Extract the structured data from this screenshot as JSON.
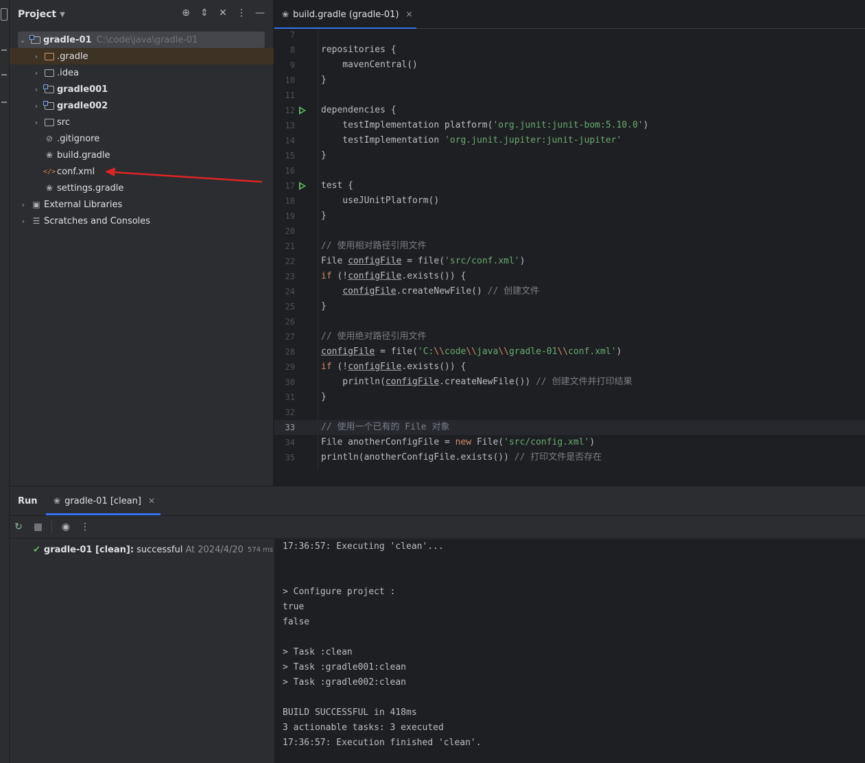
{
  "project_panel": {
    "title": "Project",
    "toolbar_icons": [
      "locate-icon",
      "expand-collapse-icon",
      "collapse-all-icon",
      "more-vertical-icon",
      "minimize-icon"
    ],
    "tree": [
      {
        "label": "gradle-01",
        "path": "C:\\code\\java\\gradle-01",
        "icon": "module-folder-icon",
        "expanded": true,
        "bold": true
      },
      {
        "label": ".gradle",
        "icon": "folder-icon",
        "color": "#d5956c",
        "selected": true
      },
      {
        "label": ".idea",
        "icon": "folder-icon"
      },
      {
        "label": "gradle001",
        "icon": "module-folder-icon",
        "bold": true
      },
      {
        "label": "gradle002",
        "icon": "module-folder-icon",
        "bold": true
      },
      {
        "label": "src",
        "icon": "folder-icon"
      },
      {
        "label": ".gitignore",
        "icon": "ignored-file-icon"
      },
      {
        "label": "build.gradle",
        "icon": "gradle-icon"
      },
      {
        "label": "conf.xml",
        "icon": "xml-file-icon"
      },
      {
        "label": "settings.gradle",
        "icon": "gradle-icon"
      },
      {
        "label": "External Libraries",
        "icon": "library-icon"
      },
      {
        "label": "Scratches and Consoles",
        "icon": "scratches-icon"
      }
    ]
  },
  "editor": {
    "tab": {
      "label": "build.gradle (gradle-01)",
      "icon": "gradle-icon"
    },
    "current_line": "33",
    "lines": [
      {
        "n": "7",
        "html": ""
      },
      {
        "n": "8",
        "html": "repositories {"
      },
      {
        "n": "9",
        "html": "    mavenCentral()"
      },
      {
        "n": "10",
        "html": "}"
      },
      {
        "n": "11",
        "html": ""
      },
      {
        "n": "12",
        "html": "dependencies {"
      },
      {
        "n": "13",
        "html": "    testImplementation platform('org.junit:junit-bom:5.10.0')"
      },
      {
        "n": "14",
        "html": "    testImplementation 'org.junit.jupiter:junit-jupiter'"
      },
      {
        "n": "15",
        "html": "}"
      },
      {
        "n": "16",
        "html": ""
      },
      {
        "n": "17",
        "html": "test {"
      },
      {
        "n": "18",
        "html": "    useJUnitPlatform()"
      },
      {
        "n": "19",
        "html": "}"
      },
      {
        "n": "20",
        "html": ""
      },
      {
        "n": "21",
        "html": "// 使用相对路径引用文件"
      },
      {
        "n": "22",
        "html": "File configFile = file('src/conf.xml')"
      },
      {
        "n": "23",
        "html": "if (!configFile.exists()) {"
      },
      {
        "n": "24",
        "html": "    configFile.createNewFile() // 创建文件"
      },
      {
        "n": "25",
        "html": "}"
      },
      {
        "n": "26",
        "html": ""
      },
      {
        "n": "27",
        "html": "// 使用绝对路径引用文件"
      },
      {
        "n": "28",
        "html": "configFile = file('C:\\\\code\\\\java\\\\gradle-01\\\\conf.xml')"
      },
      {
        "n": "29",
        "html": "if (!configFile.exists()) {"
      },
      {
        "n": "30",
        "html": "    println(configFile.createNewFile()) // 创建文件并打印结果"
      },
      {
        "n": "31",
        "html": "}"
      },
      {
        "n": "32",
        "html": ""
      },
      {
        "n": "33",
        "html": "// 使用一个已有的 File 对象"
      },
      {
        "n": "34",
        "html": "File anotherConfigFile = new File('src/config.xml')"
      },
      {
        "n": "35",
        "html": "println(anotherConfigFile.exists()) // 打印文件是否存在"
      }
    ],
    "run_gutter_lines": [
      "12",
      "17"
    ]
  },
  "run_window": {
    "title": "Run",
    "tab": {
      "label": "gradle-01 [clean]",
      "icon": "gradle-icon"
    },
    "toolbar_icons": [
      "rerun-icon",
      "stop-icon",
      "eye-icon",
      "more-vertical-icon"
    ],
    "build": {
      "name": "gradle-01 [clean]:",
      "status": "successful",
      "time": "At 2024/4/20",
      "duration": "574 ms"
    },
    "console": [
      "17:36:57: Executing 'clean'...",
      "",
      "",
      "> Configure project :",
      "true",
      "false",
      "",
      "> Task :clean",
      "> Task :gradle001:clean",
      "> Task :gradle002:clean",
      "",
      "BUILD SUCCESSFUL in 418ms",
      "3 actionable tasks: 3 executed",
      "17:36:57: Execution finished 'clean'."
    ]
  },
  "colors": {
    "accent": "#3574f0",
    "annotation_arrow": "#e02424",
    "success": "#5fb865",
    "keyword": "#cf8e6d",
    "string": "#6aab73",
    "comment": "#7a7e85"
  }
}
